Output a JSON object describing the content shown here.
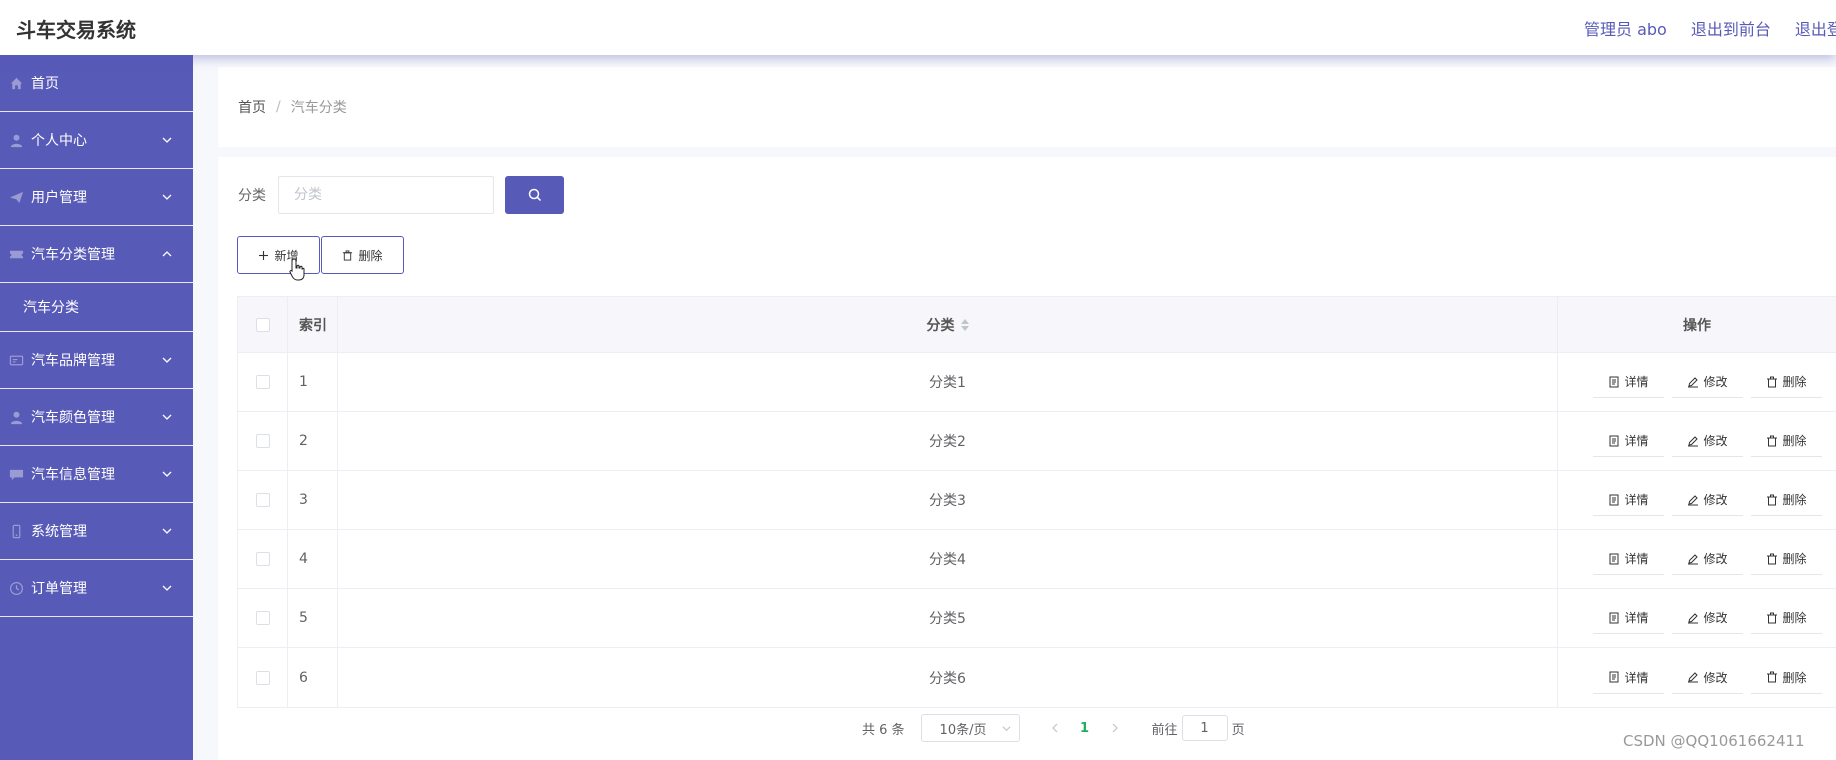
{
  "header": {
    "app_title": "斗车交易系统",
    "user_label": "管理员 abo",
    "exit_front_label": "退出到前台",
    "logout_label": "退出登录"
  },
  "sidebar": {
    "items": [
      {
        "label": "首页",
        "icon": "home-icon"
      },
      {
        "label": "个人中心",
        "icon": "user-icon"
      },
      {
        "label": "用户管理",
        "icon": "send-icon"
      },
      {
        "label": "汽车分类管理",
        "icon": "ticket-icon",
        "expanded": true
      },
      {
        "label": "汽车品牌管理",
        "icon": "card-icon"
      },
      {
        "label": "汽车颜色管理",
        "icon": "user-icon"
      },
      {
        "label": "汽车信息管理",
        "icon": "chat-icon"
      },
      {
        "label": "系统管理",
        "icon": "phone-icon"
      },
      {
        "label": "订单管理",
        "icon": "clock-icon"
      }
    ],
    "sub_item": "汽车分类"
  },
  "breadcrumb": {
    "home": "首页",
    "separator": "/",
    "current": "汽车分类"
  },
  "search": {
    "label": "分类",
    "placeholder": "分类",
    "value": ""
  },
  "actions": {
    "add_label": "新增",
    "delete_label": "删除"
  },
  "table": {
    "headers": {
      "index": "索引",
      "category": "分类",
      "ops": "操作"
    },
    "rows": [
      {
        "index": "1",
        "category": "分类1"
      },
      {
        "index": "2",
        "category": "分类2"
      },
      {
        "index": "3",
        "category": "分类3"
      },
      {
        "index": "4",
        "category": "分类4"
      },
      {
        "index": "5",
        "category": "分类5"
      },
      {
        "index": "6",
        "category": "分类6"
      }
    ],
    "op_labels": {
      "detail": "详情",
      "edit": "修改",
      "delete": "删除"
    }
  },
  "pagination": {
    "total": "共 6 条",
    "page_size": "10条/页",
    "current_page": "1",
    "goto_label": "前往",
    "goto_value": "1",
    "page_unit": "页"
  },
  "watermark": "CSDN @QQ1061662411",
  "colors": {
    "primary": "#585ab8",
    "active_page": "#20b05c"
  }
}
